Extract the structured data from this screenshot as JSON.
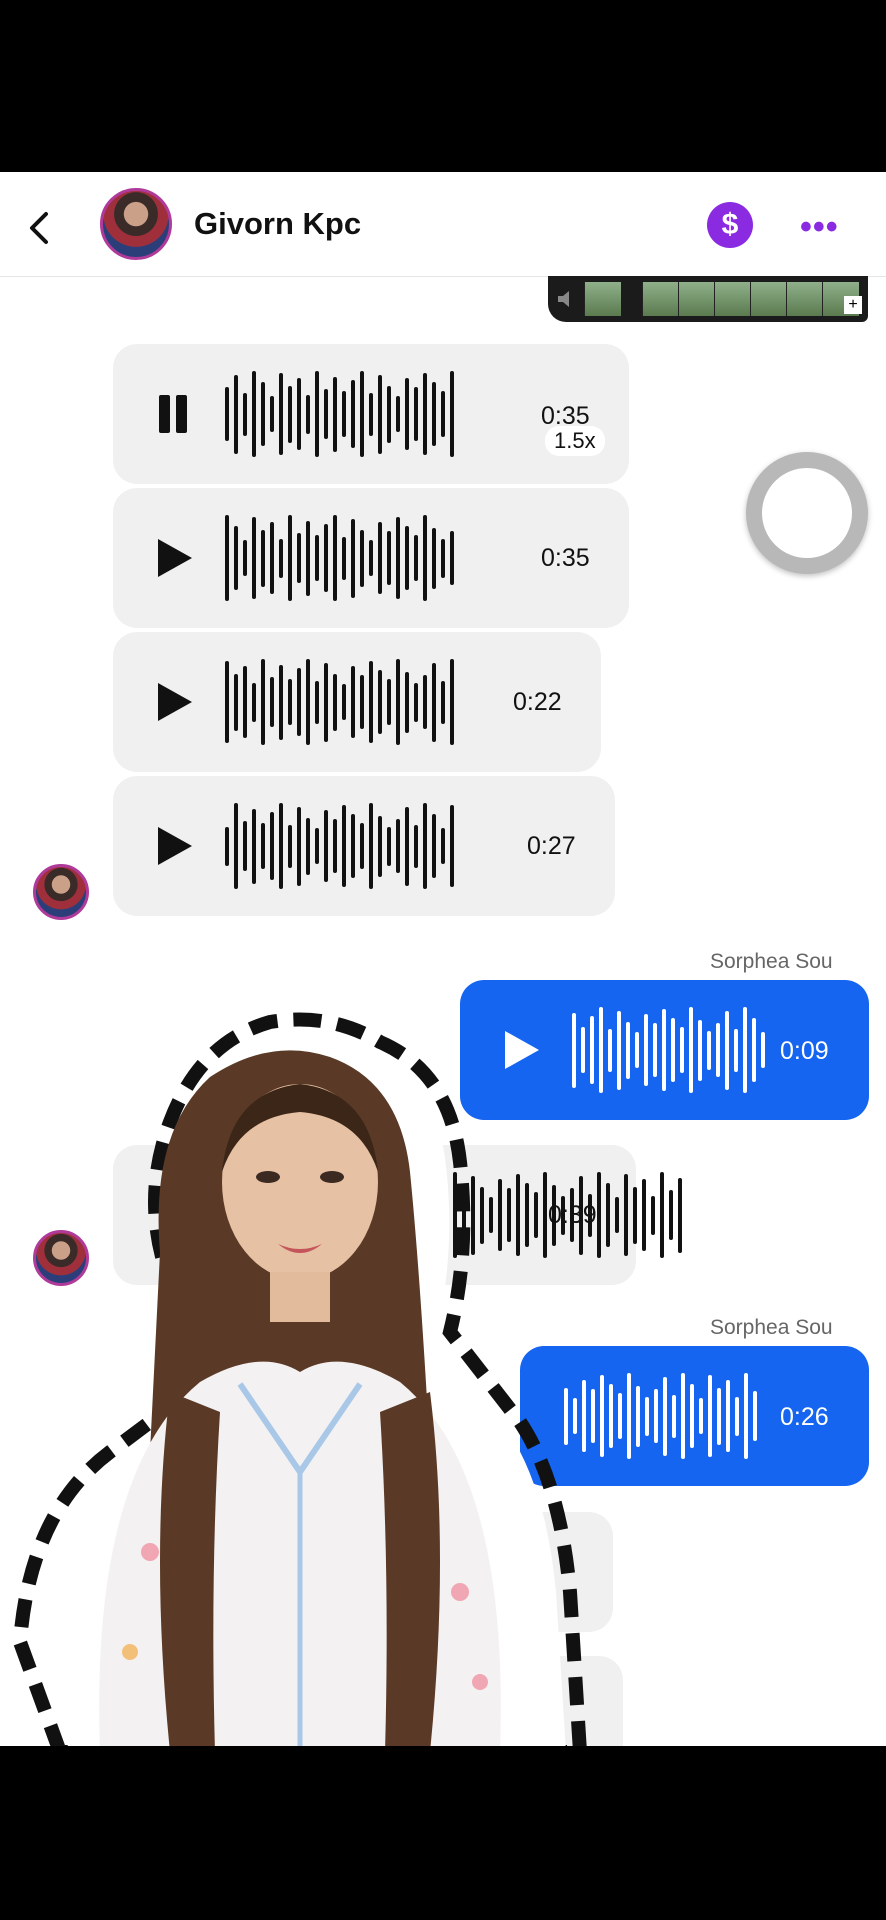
{
  "header": {
    "title": "Givorn Kpc",
    "back_icon": "chevron-left-icon",
    "pay_icon_glyph": "$",
    "more_icon_glyph": "•••",
    "accent_color": "#8a2be2"
  },
  "messages": {
    "received": [
      {
        "state": "playing",
        "duration": "0:35",
        "speed": "1.5x"
      },
      {
        "state": "paused",
        "duration": "0:35"
      },
      {
        "state": "paused",
        "duration": "0:22"
      },
      {
        "state": "paused",
        "duration": "0:27"
      },
      {
        "state": "paused",
        "duration": "0:39"
      }
    ],
    "sent": [
      {
        "sender": "Sorphea Sou",
        "duration": "0:09"
      },
      {
        "sender": "Sorphea Sou",
        "duration": "0:26"
      }
    ],
    "sent_color": "#1565f0"
  },
  "overlay": {
    "type": "person-cutout-dashed-outline"
  }
}
